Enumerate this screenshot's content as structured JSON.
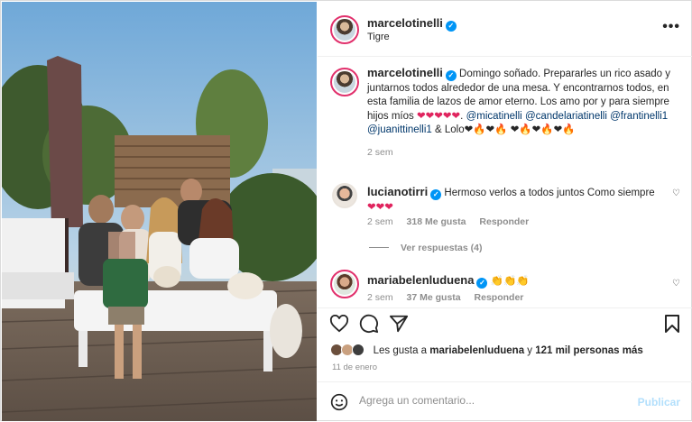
{
  "post": {
    "username": "marcelotinelli",
    "location": "Tigre",
    "more_icon": "more-horizontal-icon",
    "caption": {
      "text": "Domingo soñado. Prepararles un rico asado y juntarnos todos alrededor de una mesa. Y encontrarnos todos, en esta familia de lazos de amor eterno. Los amo por y para siempre hijos míos",
      "hearts_1": "❤❤❤❤❤",
      "mentions": [
        "@micatinelli",
        "@candelariatinelli",
        "@frantinelli1",
        "@juanittinelli1"
      ],
      "and": "& Lolo",
      "emoji_tail_1": "❤🔥❤🔥",
      "emoji_tail_2": "❤🔥❤🔥❤🔥",
      "time": "2 sem"
    },
    "comments": [
      {
        "username": "lucianotirri",
        "text": "Hermoso verlos a todos juntos Como siempre",
        "emoji": "❤❤❤",
        "time": "2 sem",
        "likes": "318 Me gusta",
        "reply": "Responder",
        "view_replies": "Ver respuestas (4)"
      },
      {
        "username": "mariabelenluduena",
        "text": "",
        "emoji": "👏👏👏",
        "time": "2 sem",
        "likes": "37 Me gusta",
        "reply": "Responder"
      }
    ],
    "likes": {
      "prefix": "Les gusta a",
      "user": "mariabelenluduena",
      "connector": "y",
      "count": "121 mil personas más"
    },
    "date": "11 de enero",
    "add_comment": {
      "placeholder": "Agrega un comentario...",
      "publish": "Publicar"
    },
    "colors": {
      "link": "#00376b",
      "verified": "#0095f6",
      "muted": "#8e8e8e",
      "publish_disabled": "#b2dffc"
    }
  }
}
